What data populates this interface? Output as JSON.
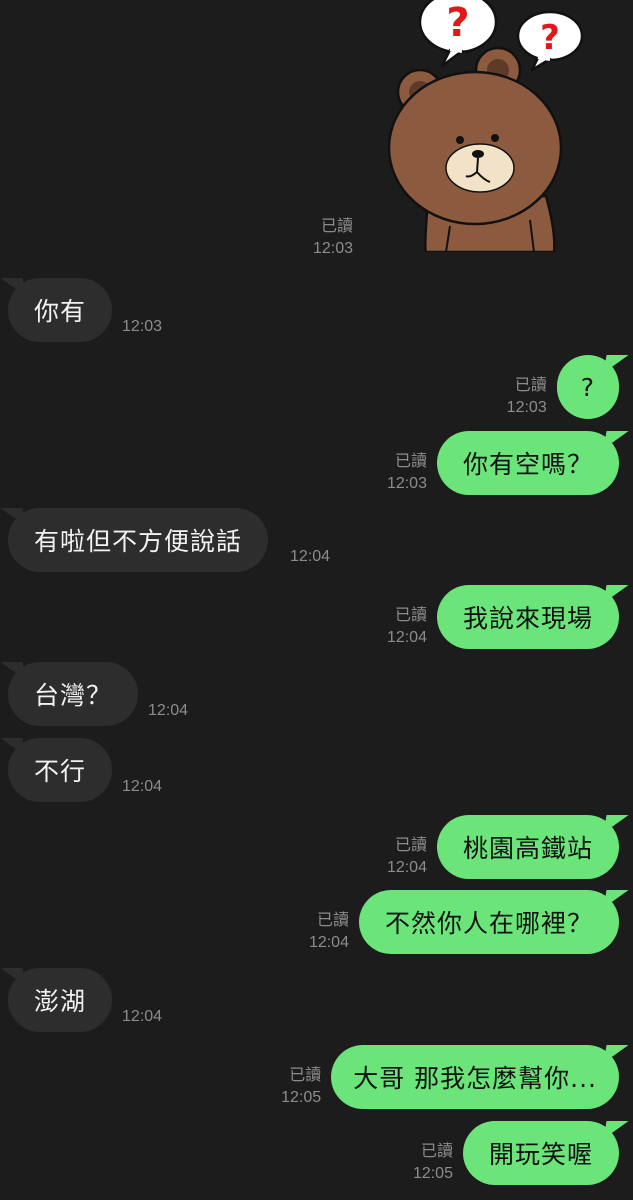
{
  "sticker": {
    "icon": "bear-question-sticker-icon",
    "read_label": "已讀",
    "time": "12:03"
  },
  "messages": [
    {
      "side": "them",
      "text": "你有",
      "time": "12:03"
    },
    {
      "side": "me",
      "text": "?",
      "read": "已讀",
      "time": "12:03"
    },
    {
      "side": "me",
      "text": "你有空嗎？",
      "read": "已讀",
      "time": "12:03"
    },
    {
      "side": "them",
      "text": "有啦但不方便說話",
      "time": "12:04"
    },
    {
      "side": "me",
      "text": "我說來現場",
      "read": "已讀",
      "time": "12:04"
    },
    {
      "side": "them",
      "text": "台灣？",
      "time": "12:04"
    },
    {
      "side": "them",
      "text": "不行",
      "time": "12:04"
    },
    {
      "side": "me",
      "text": "桃園高鐵站",
      "read": "已讀",
      "time": "12:04"
    },
    {
      "side": "me",
      "text": "不然你人在哪裡？",
      "read": "已讀",
      "time": "12:04"
    },
    {
      "side": "them",
      "text": "澎湖",
      "time": "12:04"
    },
    {
      "side": "me",
      "text": "大哥 那我怎麼幫你...",
      "read": "已讀",
      "time": "12:05"
    },
    {
      "side": "me",
      "text": "開玩笑喔",
      "read": "已讀",
      "time": "12:05"
    }
  ],
  "colors": {
    "background": "#1c1c1c",
    "my_bubble": "#6be47a",
    "their_bubble": "#2d2d2d",
    "meta_text": "#8c8c8c"
  }
}
